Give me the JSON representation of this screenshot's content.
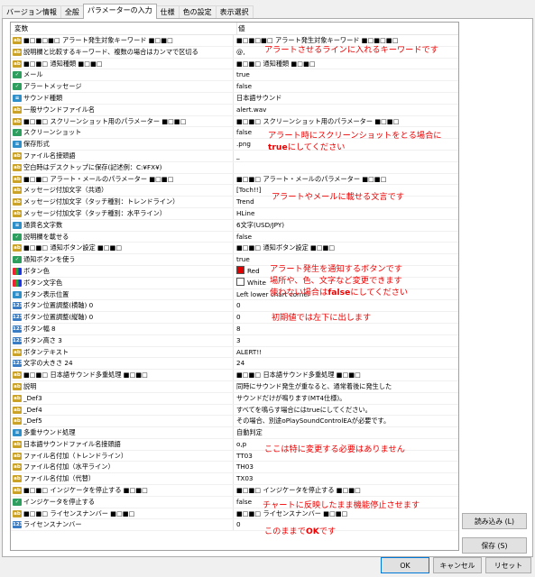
{
  "tabs": [
    "バージョン情報",
    "全般",
    "パラメーターの入力",
    "仕様",
    "色の設定",
    "表示選択"
  ],
  "active_tab": 2,
  "grid": {
    "headers": {
      "variable": "変数",
      "value": "値"
    },
    "rows": [
      {
        "icon": "ab",
        "name": "■□■□■□ アラート発生対象キーワード ■□■□",
        "value": "■□■□■□ アラート発生対象キーワード ■□■□■□"
      },
      {
        "icon": "ab",
        "name": "説明欄と比較するキーワード、複数の場合はカンマで区切る",
        "value": "@,"
      },
      {
        "icon": "ab",
        "name": "■□■□ 通知種類 ■□■□",
        "value": "■□■□ 通知種類 ■□■□"
      },
      {
        "icon": "bool",
        "name": "メール",
        "value": "true"
      },
      {
        "icon": "bool",
        "name": "アラートメッセージ",
        "value": "false"
      },
      {
        "icon": "enm",
        "name": "サウンド種類",
        "value": "日本語サウンド"
      },
      {
        "icon": "ab",
        "name": "一般サウンドファイル名",
        "value": "alert.wav"
      },
      {
        "icon": "ab",
        "name": "■□■□ スクリーンショット用のパラメーター ■□■□",
        "value": "■□■□ スクリーンショット用のパラメーター ■□■□"
      },
      {
        "icon": "bool",
        "name": "スクリーンショット",
        "value": "false"
      },
      {
        "icon": "enm",
        "name": "保存形式",
        "value": ".png"
      },
      {
        "icon": "ab",
        "name": "ファイル名接頭語",
        "value": "_"
      },
      {
        "icon": "ab",
        "name": "空白時はデスクトップに保存(記述例：C:¥FX¥)",
        "value": ""
      },
      {
        "icon": "ab",
        "name": "■□■□ アラート・メールのパラメーター ■□■□",
        "value": "■□■□ アラート・メールのパラメーター ■□■□"
      },
      {
        "icon": "ab",
        "name": "メッセージ付加文字（共通）",
        "value": "[Toch!!]"
      },
      {
        "icon": "ab",
        "name": "メッセージ付加文字（タッチ種別：トレンドライン）",
        "value": "Trend"
      },
      {
        "icon": "ab",
        "name": "メッセージ付加文字（タッチ種別：水平ライン）",
        "value": "HLine"
      },
      {
        "icon": "enm",
        "name": "通貨名文字数",
        "value": "6文字(USD/JPY)"
      },
      {
        "icon": "bool",
        "name": "説明欄を載せる",
        "value": "false"
      },
      {
        "icon": "ab",
        "name": "■□■□ 通知ボタン設定 ■□■□",
        "value": "■□■□ 通知ボタン設定 ■□■□"
      },
      {
        "icon": "bool",
        "name": "通知ボタンを使う",
        "value": "true"
      },
      {
        "icon": "clr",
        "name": "ボタン色",
        "value": "Red",
        "swatch": "#e00000"
      },
      {
        "icon": "clr",
        "name": "ボタン文字色",
        "value": "White",
        "swatch": "#ffffff"
      },
      {
        "icon": "enm",
        "name": "ボタン表示位置",
        "value": "Left lower chart corner"
      },
      {
        "icon": "int",
        "name": "ボタン位置調整(横軸) 0",
        "value": "0"
      },
      {
        "icon": "int",
        "name": "ボタン位置調整(縦軸) 0",
        "value": "0"
      },
      {
        "icon": "int",
        "name": "ボタン幅 8",
        "value": "8"
      },
      {
        "icon": "int",
        "name": "ボタン高さ 3",
        "value": "3"
      },
      {
        "icon": "ab",
        "name": "ボタンテキスト",
        "value": "ALERT!!"
      },
      {
        "icon": "int",
        "name": "文字の大きさ 24",
        "value": "24"
      },
      {
        "icon": "ab",
        "name": "■□■□ 日本語サウンド多重処理 ■□■□",
        "value": "■□■□ 日本語サウンド多重処理 ■□■□"
      },
      {
        "icon": "ab",
        "name": "説明",
        "value": "同時にサウンド発生が重なると、通常着後に発生した"
      },
      {
        "icon": "ab",
        "name": "_Def3",
        "value": "サウンドだけが鳴ります(MT4仕様)。"
      },
      {
        "icon": "ab",
        "name": "_Def4",
        "value": "すべてを鳴らす場合にはtrueにしてください。"
      },
      {
        "icon": "ab",
        "name": "_Def5",
        "value": "その場合、別途oPlaySoundControlEAが必要です。"
      },
      {
        "icon": "enm",
        "name": "多重サウンド処理",
        "value": "自動判定"
      },
      {
        "icon": "ab",
        "name": "日本語サウンドファイル名接頭語",
        "value": "o,p"
      },
      {
        "icon": "ab",
        "name": "ファイル名付加（トレンドライン）",
        "value": "TT03"
      },
      {
        "icon": "ab",
        "name": "ファイル名付加（水平ライン）",
        "value": "TH03"
      },
      {
        "icon": "ab",
        "name": "ファイル名付加（代替）",
        "value": "TX03"
      },
      {
        "icon": "ab",
        "name": "■□■□ インジケータを停止する ■□■□",
        "value": "■□■□ インジケータを停止する ■□■□"
      },
      {
        "icon": "bool",
        "name": "インジケータを停止する",
        "value": "false"
      },
      {
        "icon": "ab",
        "name": "■□■□ ライセンスナンバー ■□■□",
        "value": "■□■□ ライセンスナンバー ■□■□"
      },
      {
        "icon": "int",
        "name": "ライセンスナンバー",
        "value": "0"
      }
    ]
  },
  "annotations": [
    {
      "text": "アラートさせるラインに入れるキーワードです"
    },
    {
      "text": "アラート時にスクリーンショットをとる場合に"
    },
    {
      "text_bold": "true",
      "text_rest": "にしてください"
    },
    {
      "text": "アラートやメールに載せる文言です"
    },
    {
      "text": "アラート発生を通知するボタンです"
    },
    {
      "text": "場所や、色、文字など変更できます"
    },
    {
      "text_pre": "使わない場合は",
      "text_bold": "false",
      "text_rest": "にしてください"
    },
    {
      "text": "初期値では左下に出します"
    },
    {
      "text": "ここは特に変更する必要はありません"
    },
    {
      "text": "チャートに反映したまま機能停止させます"
    },
    {
      "text_pre": "このままで",
      "text_bold": "OK",
      "text_rest": "です"
    }
  ],
  "side_buttons": {
    "load": "読み込み (L)",
    "save": "保存 (S)"
  },
  "footer_buttons": {
    "ok": "OK",
    "cancel": "キャンセル",
    "reset": "リセット"
  }
}
